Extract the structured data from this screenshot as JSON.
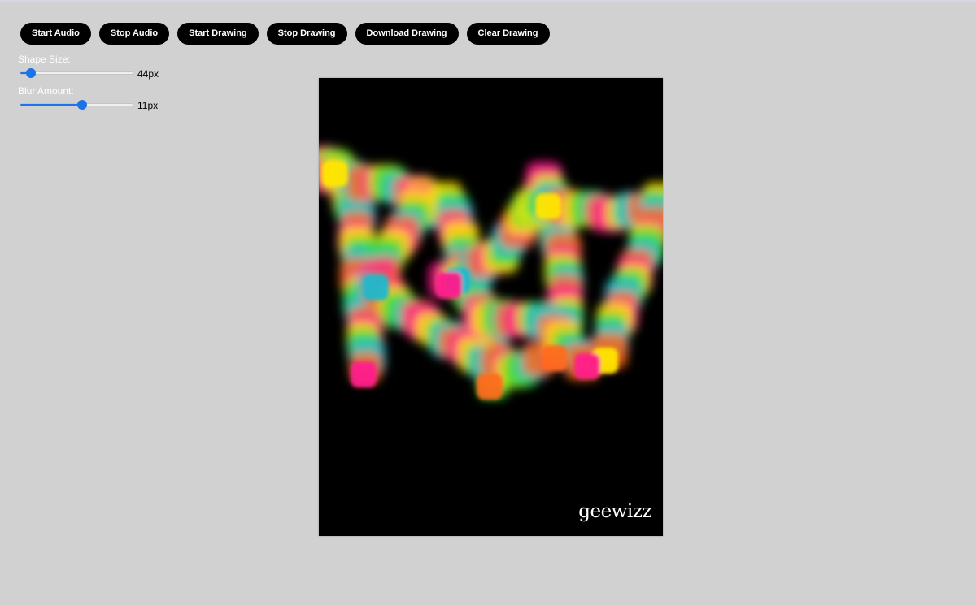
{
  "toolbar": {
    "buttons": [
      {
        "label": "Start Audio"
      },
      {
        "label": "Stop Audio"
      },
      {
        "label": "Start Drawing"
      },
      {
        "label": "Stop Drawing"
      },
      {
        "label": "Download Drawing"
      },
      {
        "label": "Clear Drawing"
      }
    ]
  },
  "controls": {
    "shape_size": {
      "label": "Shape Size:",
      "value_text": "44px",
      "fraction": 0.1
    },
    "blur_amount": {
      "label": "Blur Amount:",
      "value_text": "11px",
      "fraction": 0.55
    }
  },
  "canvas": {
    "brand": "geewizz",
    "background": "#000000",
    "palette": [
      "#ff1a8c",
      "#ffe600",
      "#33dd33",
      "#20b8cc",
      "#ff6a1a"
    ]
  }
}
